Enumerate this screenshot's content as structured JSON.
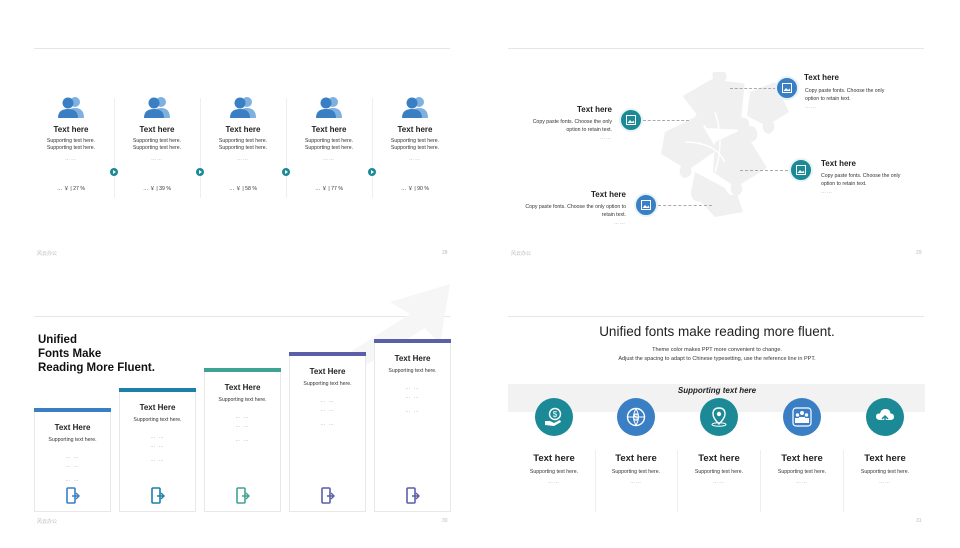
{
  "colors": {
    "teal": "#1b8a96",
    "blue": "#3a7fc4",
    "indigo": "#5a5fa8",
    "green": "#3fa394"
  },
  "slides": [
    {
      "footer": "风云办公",
      "page": "28",
      "items": [
        {
          "title": "Text here",
          "line1": "Supporting text here.",
          "line2": "Supporting text here.",
          "dots": "……",
          "stat": "… ￥ | 27 %",
          "icon": "user-group-icon"
        },
        {
          "title": "Text here",
          "line1": "Supporting text here.",
          "line2": "Supporting text here.",
          "dots": "……",
          "stat": "… ￥ | 39 %",
          "icon": "user-group-icon"
        },
        {
          "title": "Text here",
          "line1": "Supporting text here.",
          "line2": "Supporting text here.",
          "dots": "……",
          "stat": "… ￥ | 58 %",
          "icon": "user-group-icon"
        },
        {
          "title": "Text here",
          "line1": "Supporting text here.",
          "line2": "Supporting text here.",
          "dots": "……",
          "stat": "… ￥ | 77 %",
          "icon": "user-group-icon"
        },
        {
          "title": "Text here",
          "line1": "Supporting text here.",
          "line2": "Supporting text here.",
          "dots": "……",
          "stat": "… ￥ | 90 %",
          "icon": "user-group-icon"
        }
      ]
    },
    {
      "footer": "风云办公",
      "page": "29",
      "items": [
        {
          "title": "Text here",
          "line1": "Copy paste fonts. Choose the only",
          "line2": "option to retain text.",
          "dots": "……"
        },
        {
          "title": "Text here",
          "line1": "Copy paste fonts. Choose the only",
          "line2": "option to retain text.",
          "dots": "……"
        },
        {
          "title": "Text here",
          "line1": "Copy paste fonts. Choose the only",
          "line2": "option to retain text.",
          "dots": "……"
        },
        {
          "title": "Text here",
          "line1": "Copy paste fonts. Choose the only option to",
          "line2": "retain text.",
          "dots": "……"
        }
      ]
    },
    {
      "footer": "风云办公",
      "page": "30",
      "heading": [
        "Unified",
        "Fonts Make",
        "Reading More Fluent."
      ],
      "cols": [
        {
          "title": "Text Here",
          "sub": "Supporting text here.",
          "d1": "… …",
          "d2": "… …",
          "d3": "… …"
        },
        {
          "title": "Text Here",
          "sub": "Supporting text here.",
          "d1": "… …",
          "d2": "… …",
          "d3": "… …"
        },
        {
          "title": "Text Here",
          "sub": "Supporting text here.",
          "d1": "… …",
          "d2": "… …",
          "d3": "… …"
        },
        {
          "title": "Text Here",
          "sub": "Supporting text here.",
          "d1": "… …",
          "d2": "… …",
          "d3": "… …"
        },
        {
          "title": "Text Here",
          "sub": "Supporting text here.",
          "d1": "… …",
          "d2": "… …",
          "d3": "… …"
        }
      ]
    },
    {
      "footer": "",
      "page": "31",
      "title": "Unified fonts make reading more fluent.",
      "sub1": "Theme color makes PPT more convenient to change.",
      "sub2": "Adjust the spacing to adapt to Chinese typesetting, use the reference line in PPT.",
      "band": "Supporting text here",
      "items": [
        {
          "title": "Text here",
          "sub": "Supporting text here.",
          "dots": "……",
          "icon": "money-hand-icon"
        },
        {
          "title": "Text here",
          "sub": "Supporting text here.",
          "dots": "……",
          "icon": "dollar-globe-icon"
        },
        {
          "title": "Text here",
          "sub": "Supporting text here.",
          "dots": "……",
          "icon": "map-pin-icon"
        },
        {
          "title": "Text here",
          "sub": "Supporting text here.",
          "dots": "……",
          "icon": "team-icon"
        },
        {
          "title": "Text here",
          "sub": "Supporting text here.",
          "dots": "……",
          "icon": "cloud-upload-icon"
        }
      ]
    }
  ]
}
